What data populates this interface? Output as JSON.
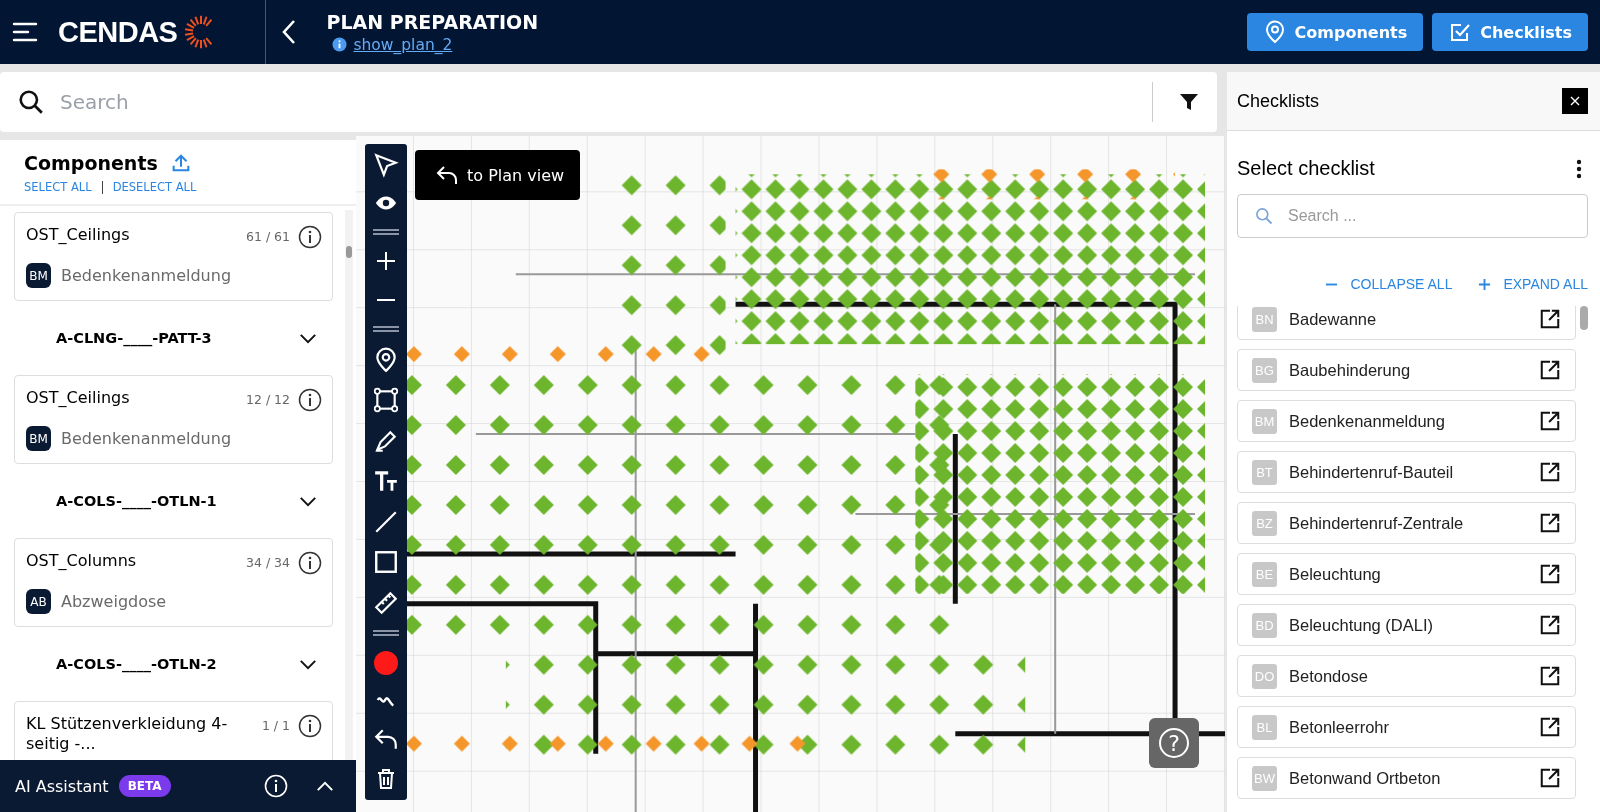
{
  "header": {
    "logo": "CENDAS",
    "title": "PLAN PREPARATION",
    "plan_link": "show_plan_2",
    "buttons": [
      {
        "kind": "components",
        "label": "Components"
      },
      {
        "kind": "checklists",
        "label": "Checklists"
      }
    ]
  },
  "search": {
    "placeholder": "Search"
  },
  "components_panel": {
    "title": "Components",
    "select_all": "SELECT ALL",
    "deselect_all": "DESELECT ALL",
    "items": [
      {
        "kind": "card",
        "title": "OST_Ceilings",
        "count": "61 / 61",
        "badge": "BM",
        "label": "Bedenkenanmeldung"
      },
      {
        "kind": "group",
        "title": "A-CLNG-____-PATT-3",
        "expanded": false
      },
      {
        "kind": "card",
        "title": "OST_Ceilings",
        "count": "12 / 12",
        "badge": "BM",
        "label": "Bedenkenanmeldung"
      },
      {
        "kind": "group",
        "title": "A-COLS-____-OTLN-1",
        "expanded": false
      },
      {
        "kind": "card",
        "title": "OST_Columns",
        "count": "34 / 34",
        "badge": "AB",
        "label": "Abzweigdose"
      },
      {
        "kind": "group",
        "title": "A-COLS-____-OTLN-2",
        "expanded": false
      },
      {
        "kind": "card",
        "title": "KL Stützenverkleidung 4-seitig -...",
        "count": "1 / 1"
      }
    ]
  },
  "ai_assistant": {
    "label": "AI Assistant",
    "badge": "BETA",
    "expanded": false
  },
  "toolbar": {
    "color": "#ff1a1a"
  },
  "plan": {
    "kind": "picture",
    "back_button": "to Plan view",
    "help": "?"
  },
  "checklists_panel": {
    "title": "Checklists",
    "heading": "Select checklist",
    "search_placeholder": "Search ...",
    "collapse_all": "COLLAPSE ALL",
    "expand_all": "EXPAND ALL",
    "items": [
      {
        "code": "BN",
        "label": "Badewanne"
      },
      {
        "code": "BG",
        "label": "Baubehinderung"
      },
      {
        "code": "BM",
        "label": "Bedenkenanmeldung"
      },
      {
        "code": "BT",
        "label": "Behindertenruf-Bauteil"
      },
      {
        "code": "BZ",
        "label": "Behindertenruf-Zentrale"
      },
      {
        "code": "BE",
        "label": "Beleuchtung"
      },
      {
        "code": "BD",
        "label": "Beleuchtung (DALI)"
      },
      {
        "code": "DO",
        "label": "Betondose"
      },
      {
        "code": "BL",
        "label": "Betonleerrohr"
      },
      {
        "code": "BW",
        "label": "Betonwand Ortbeton"
      }
    ]
  }
}
